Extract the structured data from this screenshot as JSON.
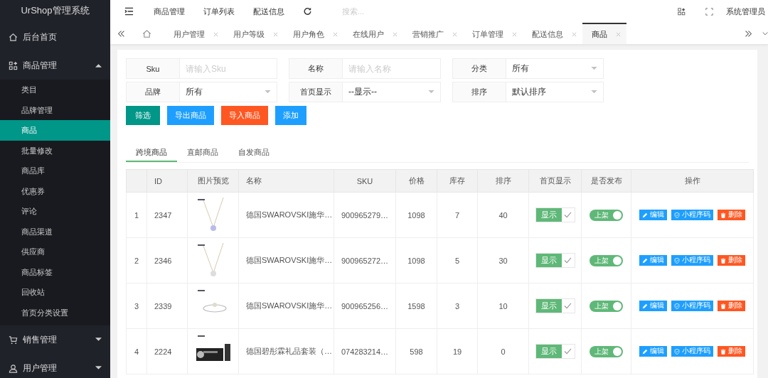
{
  "sidebar": {
    "title": "UrShop管理系统",
    "items": [
      {
        "label": "后台首页"
      },
      {
        "label": "商品管理",
        "expanded": true,
        "children": [
          {
            "label": "类目",
            "selected": false
          },
          {
            "label": "品牌管理",
            "selected": false
          },
          {
            "label": "商品",
            "selected": true
          },
          {
            "label": "批量修改",
            "selected": false
          },
          {
            "label": "商品库",
            "selected": false
          },
          {
            "label": "优惠券",
            "selected": false
          },
          {
            "label": "评论",
            "selected": false
          },
          {
            "label": "商品渠道",
            "selected": false
          },
          {
            "label": "供应商",
            "selected": false
          },
          {
            "label": "商品标签",
            "selected": false
          },
          {
            "label": "回收站",
            "selected": false
          },
          {
            "label": "首页分类设置",
            "selected": false
          }
        ]
      },
      {
        "label": "销售管理",
        "expanded": false
      },
      {
        "label": "用户管理",
        "expanded": false
      }
    ]
  },
  "header": {
    "links": [
      "商品管理",
      "订单列表",
      "配送信息"
    ],
    "search": {
      "placeholder": "搜索..."
    },
    "user": "系统管理员"
  },
  "tabs": [
    {
      "label": "用户管理",
      "selected": false
    },
    {
      "label": "用户等级",
      "selected": false
    },
    {
      "label": "用户角色",
      "selected": false
    },
    {
      "label": "在线用户",
      "selected": false
    },
    {
      "label": "营销推广",
      "selected": false
    },
    {
      "label": "订单管理",
      "selected": false
    },
    {
      "label": "配送信息",
      "selected": false
    },
    {
      "label": "商品",
      "selected": true
    }
  ],
  "filters": [
    {
      "label": "Sku",
      "kind": "input",
      "placeholder": "请输入Sku"
    },
    {
      "label": "名称",
      "kind": "input",
      "placeholder": "请输入名称"
    },
    {
      "label": "分类",
      "kind": "select",
      "value": "所有"
    },
    {
      "label": "品牌",
      "kind": "select",
      "value": "所有"
    },
    {
      "label": "首页显示",
      "kind": "select",
      "value": "--显示--"
    },
    {
      "label": "排序",
      "kind": "select",
      "value": "默认排序"
    }
  ],
  "buttons": [
    {
      "label": "筛选",
      "color": "#009688"
    },
    {
      "label": "导出商品",
      "color": "#1e9fff"
    },
    {
      "label": "导入商品",
      "color": "#ff5722"
    },
    {
      "label": "添加",
      "color": "#1e9fff"
    }
  ],
  "subtabs": [
    {
      "label": "跨境商品",
      "selected": true
    },
    {
      "label": "直邮商品",
      "selected": false
    },
    {
      "label": "自发商品",
      "selected": false
    }
  ],
  "table": {
    "columns": [
      "ID",
      "图片预览",
      "名称",
      "SKU",
      "价格",
      "库存",
      "排序",
      "首页显示",
      "是否发布",
      "操作"
    ],
    "rows": [
      {
        "index": "1",
        "id": "2347",
        "image": {
          "kind": "picture"
        },
        "name": "德国SWAROVSKI施华…",
        "sku": "900965279…",
        "price": "1098",
        "stock": "7",
        "sort": "40",
        "showcase": {
          "label": "显示",
          "checked": true
        },
        "published": {
          "label": "上架",
          "on": true
        },
        "actions": [
          "编辑",
          "小程序码",
          "删除"
        ]
      },
      {
        "index": "2",
        "id": "2346",
        "image": {
          "kind": "picture"
        },
        "name": "德国SWAROVSKI施华…",
        "sku": "900965272…",
        "price": "1098",
        "stock": "5",
        "sort": "30",
        "showcase": {
          "label": "显示",
          "checked": true
        },
        "published": {
          "label": "上架",
          "on": true
        },
        "actions": [
          "编辑",
          "小程序码",
          "删除"
        ]
      },
      {
        "index": "3",
        "id": "2339",
        "image": {
          "kind": "picture"
        },
        "name": "德国SWAROVSKI施华…",
        "sku": "900965256…",
        "price": "1598",
        "stock": "3",
        "sort": "10",
        "showcase": {
          "label": "显示",
          "checked": true
        },
        "published": {
          "label": "上架",
          "on": true
        },
        "actions": [
          "编辑",
          "小程序码",
          "删除"
        ]
      },
      {
        "index": "4",
        "id": "2224",
        "image": {
          "kind": "picture"
        },
        "name": "德国碧彤霖礼品套装（…",
        "sku": "074283214…",
        "price": "598",
        "stock": "19",
        "sort": "0",
        "showcase": {
          "label": "显示",
          "checked": true
        },
        "published": {
          "label": "上架",
          "on": true
        },
        "actions": [
          "编辑",
          "小程序码",
          "删除"
        ]
      }
    ]
  }
}
